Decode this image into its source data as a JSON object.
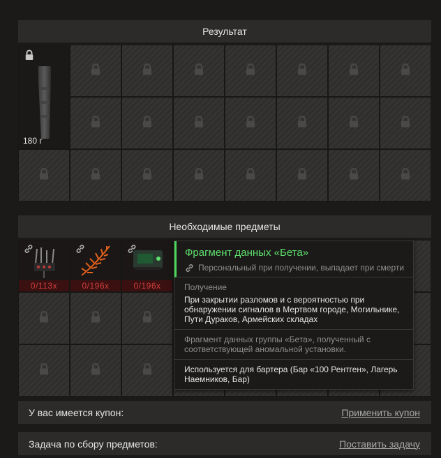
{
  "result": {
    "title": "Результат",
    "item": {
      "weight": "180 г",
      "icon": "magazine-icon"
    }
  },
  "required": {
    "title": "Необходимые предметы",
    "items": [
      {
        "count": "0/113х",
        "icon": "cable-item-icon"
      },
      {
        "count": "0/196х",
        "icon": "fern-item-icon"
      },
      {
        "count": "0/196х",
        "icon": "data-device-icon"
      }
    ]
  },
  "tooltip": {
    "title": "Фрагмент данных «Бета»",
    "binding": "Персональный при получении, выпадает при смерти",
    "obtain_label": "Получение",
    "obtain_text": "При закрытии разломов и с вероятностью при обнаружении сигналов в Мертвом городе, Могильнике, Пути Дураков, Армейских складах",
    "description": "Фрагмент данных группы «Бета», полученный с соответствующей аномальной установки.",
    "usage": "Используется для бартера (Бар «100 Рентген», Лагерь Наемников, Бар)",
    "accent_color": "#5ee06c"
  },
  "coupon": {
    "label": "У вас имеется купон:",
    "action": "Применить купон"
  },
  "task": {
    "label": "Задача по сбору предметов:",
    "action": "Поставить задачу"
  }
}
